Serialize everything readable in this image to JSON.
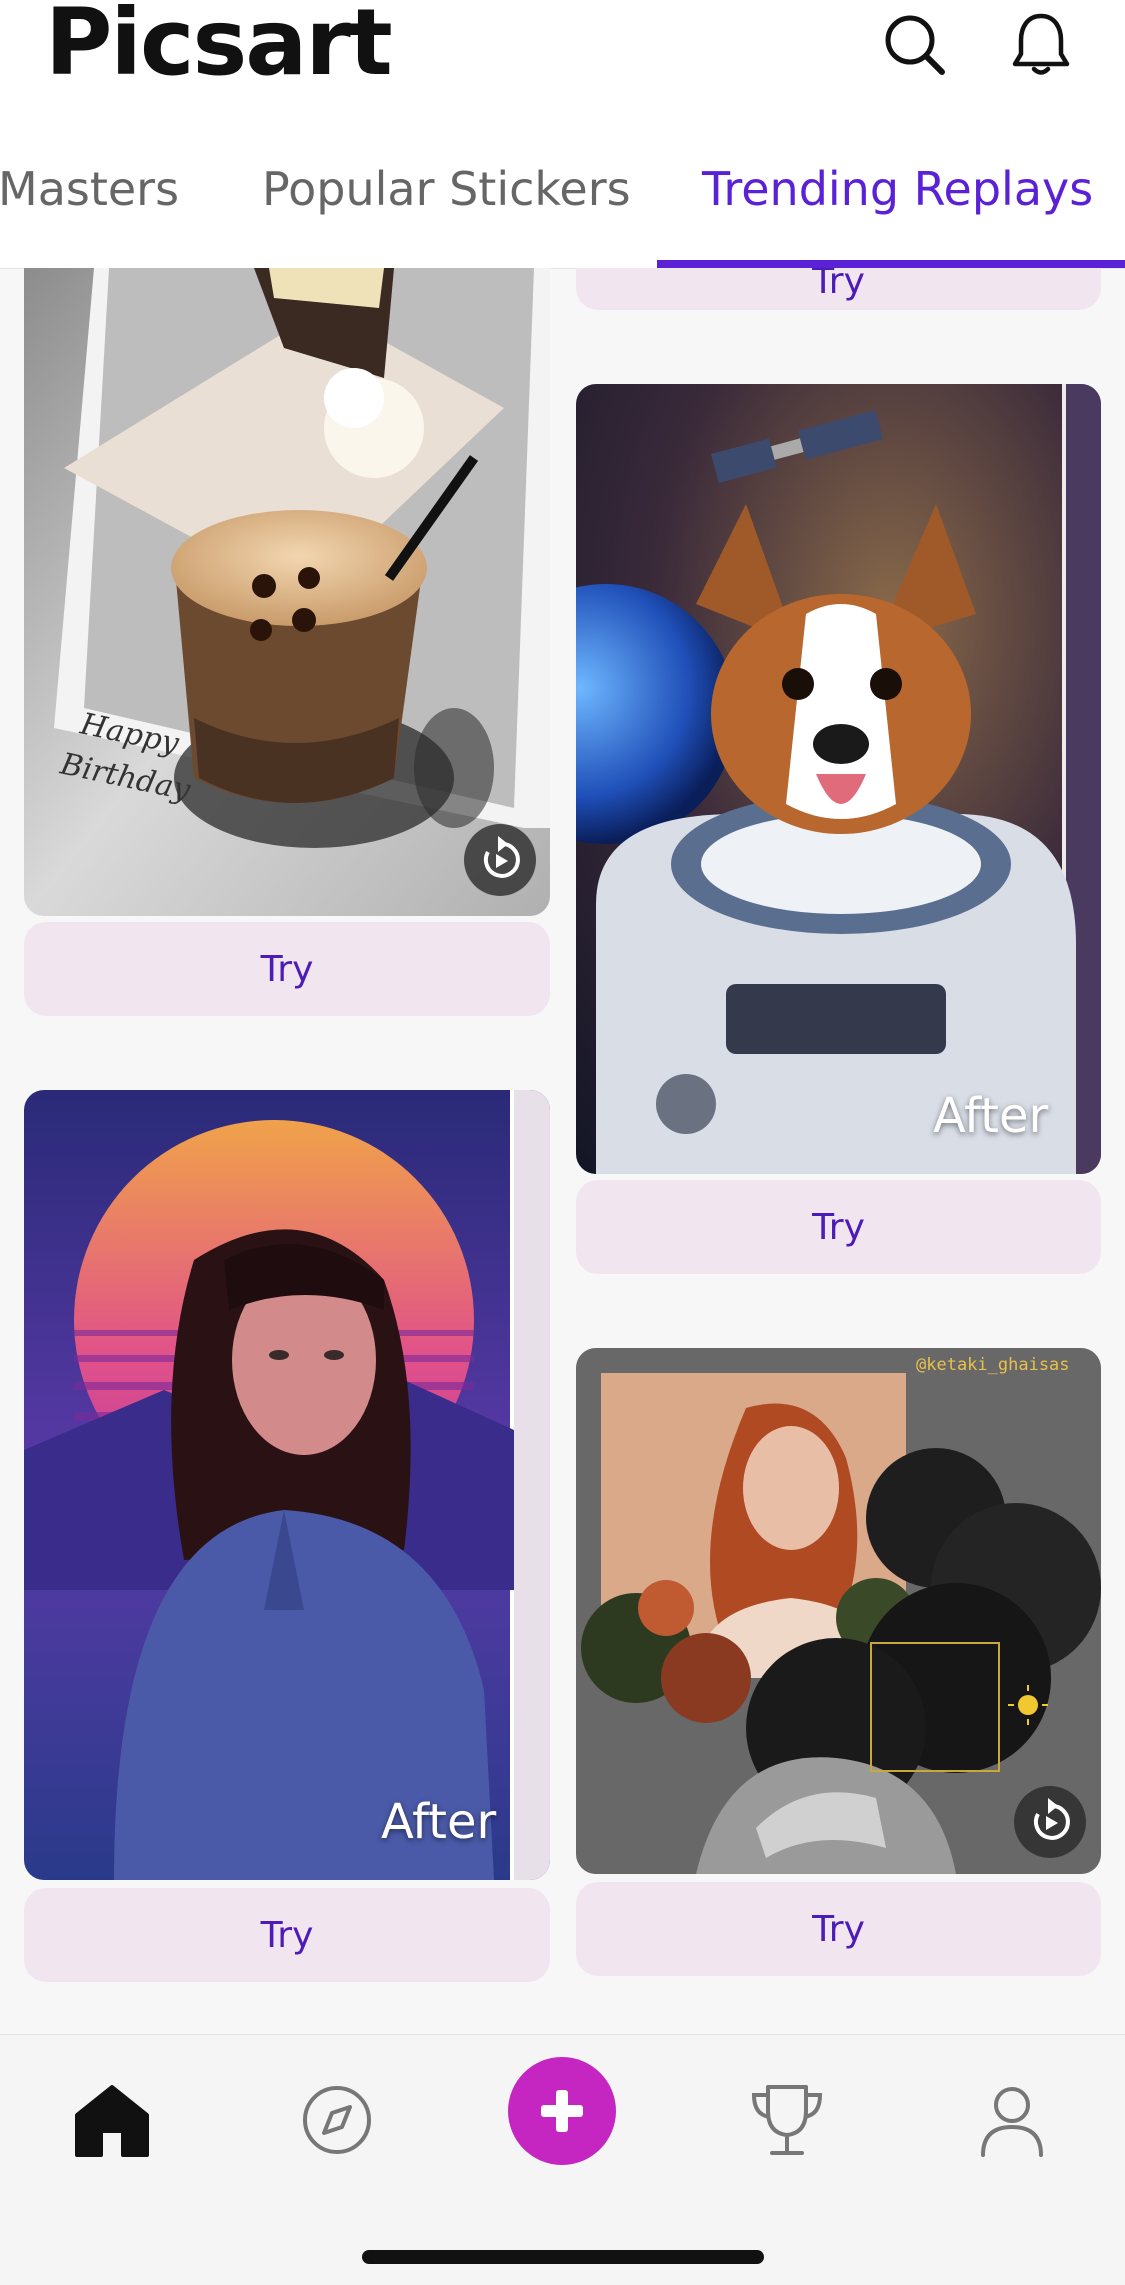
{
  "app": {
    "logo_text": "Picsart"
  },
  "header": {
    "icons": [
      "search-icon",
      "notification-bell-icon"
    ]
  },
  "tabs": [
    {
      "label": "Masters",
      "active": false
    },
    {
      "label": "Popular Stickers",
      "active": false
    },
    {
      "label": "Trending Replays",
      "active": true
    }
  ],
  "feed": {
    "cards": [
      {
        "image": "coffee-cake-birthday-photo",
        "handwriting": "Happy Birthday",
        "badge": "replay-icon",
        "try_label": "Try"
      },
      {
        "image": "corgi-astronaut-space",
        "overlay": "After",
        "try_label": "Try"
      },
      {
        "image": "girl-retro-sunset",
        "overlay": "After",
        "try_label": "Try"
      },
      {
        "image": "woman-flowers-collage",
        "watermark": "@ketaki_ghaisas",
        "badge": "replay-icon",
        "try_label": "Try"
      }
    ],
    "partial_top_button_label": "Try"
  },
  "bottom_nav": {
    "items": [
      "home-icon",
      "explore-compass-icon",
      "create-plus-icon",
      "challenges-trophy-icon",
      "profile-icon"
    ],
    "accent_color": "#c526c2"
  },
  "colors": {
    "accent": "#5a21d6",
    "try_bg": "#f1e5f0",
    "try_text": "#4d1bb8"
  }
}
